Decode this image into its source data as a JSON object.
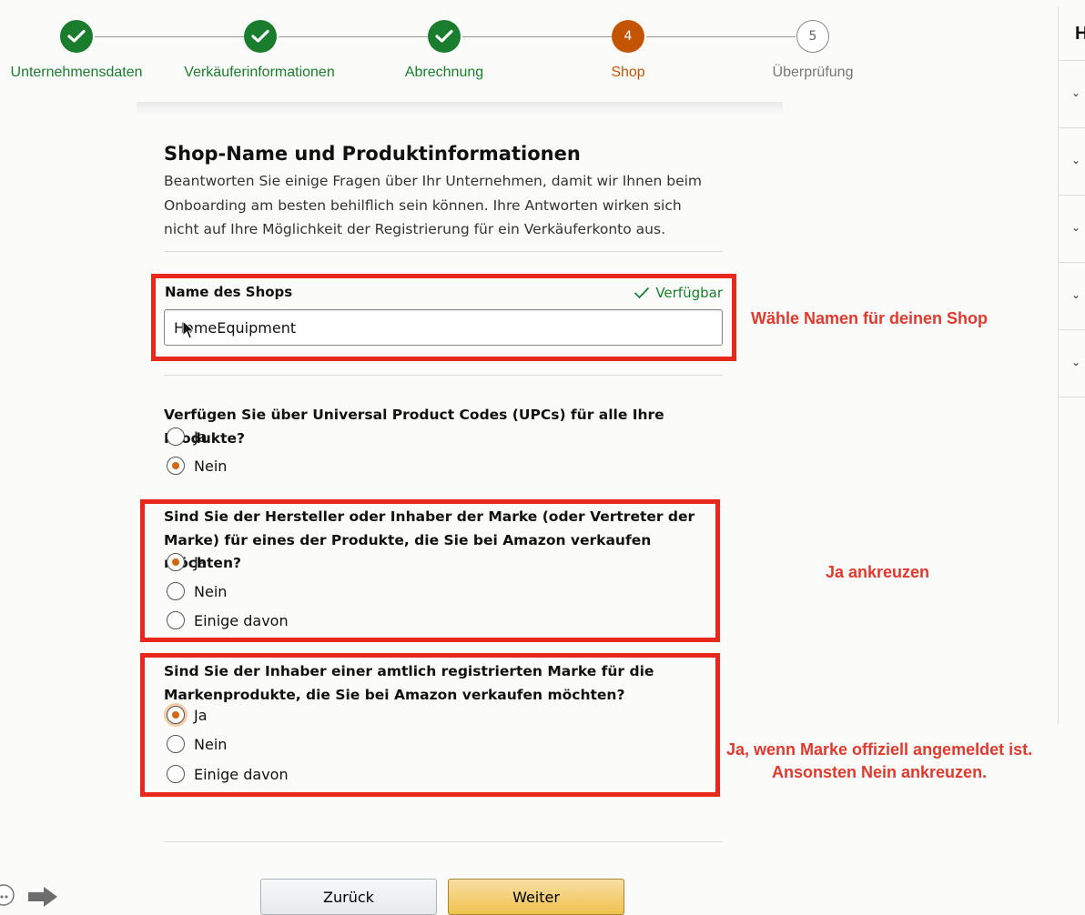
{
  "stepper": {
    "steps": [
      {
        "label": "Unternehmensdaten",
        "state": "done"
      },
      {
        "label": "Verkäuferinformationen",
        "state": "done"
      },
      {
        "label": "Abrechnung",
        "state": "done"
      },
      {
        "label": "Shop",
        "number": "4",
        "state": "current"
      },
      {
        "label": "Überprüfung",
        "number": "5",
        "state": "future"
      }
    ]
  },
  "right_panel": {
    "heading": "H"
  },
  "section": {
    "title": "Shop-Name und Produktinformationen",
    "intro": "Beantworten Sie einige Fragen über Ihr Unternehmen, damit wir Ihnen beim Onboarding am besten behilflich sein können. Ihre Antworten wirken sich nicht auf Ihre Möglichkeit der Registrierung für ein Verkäuferkonto aus."
  },
  "shop_name": {
    "label": "Name des Shops",
    "value": "HomeEquipment",
    "status": "Verfügbar"
  },
  "q_upc": {
    "question": "Verfügen Sie über Universal Product Codes (UPCs) für alle Ihre Produkte?",
    "options": [
      "Ja",
      "Nein"
    ],
    "selected": "Nein"
  },
  "q_manufacturer": {
    "question": "Sind Sie der Hersteller oder Inhaber der Marke (oder Vertreter der Marke) für eines der Produkte, die Sie bei Amazon verkaufen möchten?",
    "options": [
      "Ja",
      "Nein",
      "Einige davon"
    ],
    "selected": "Ja"
  },
  "q_trademark": {
    "question": "Sind Sie der Inhaber einer amtlich registrierten Marke für die Markenprodukte, die Sie bei Amazon verkaufen möchten?",
    "options": [
      "Ja",
      "Nein",
      "Einige davon"
    ],
    "selected": "Ja"
  },
  "annotations": {
    "shop_name_note": "Wähle Namen für deinen Shop",
    "manufacturer_note": "Ja ankreuzen",
    "trademark_note_1": "Ja, wenn Marke offiziell angemeldet ist.",
    "trademark_note_2": "Ansonsten Nein ankreuzen."
  },
  "buttons": {
    "back": "Zurück",
    "next": "Weiter"
  },
  "colors": {
    "done": "#1a7d2e",
    "current": "#c45500",
    "annotation_red": "#e8281b",
    "primary_button": "#f0c14b"
  }
}
